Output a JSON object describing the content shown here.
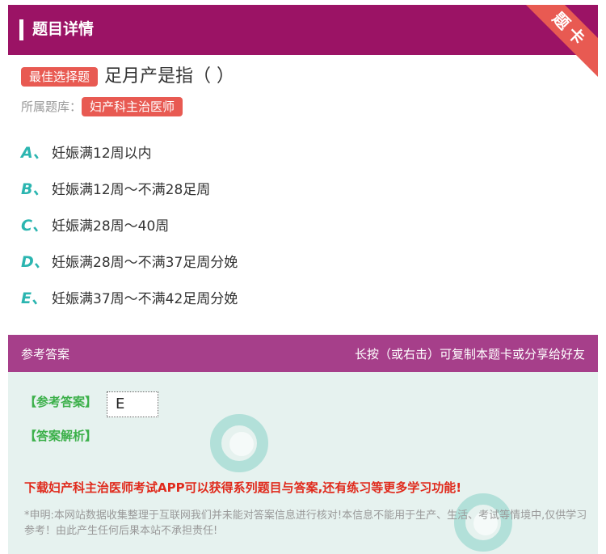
{
  "header": {
    "title": "题目详情",
    "corner_label": "题卡"
  },
  "question": {
    "type_tag": "最佳选择题",
    "text": "足月产是指（ ）"
  },
  "bank": {
    "label": "所属题库：",
    "name": "妇产科主治医师"
  },
  "options": [
    {
      "letter": "A、",
      "text": "妊娠满12周以内"
    },
    {
      "letter": "B、",
      "text": "妊娠满12周～不满28足周"
    },
    {
      "letter": "C、",
      "text": "妊娠满28周～40周"
    },
    {
      "letter": "D、",
      "text": "妊娠满28周～不满37足周分娩"
    },
    {
      "letter": "E、",
      "text": "妊娠满37周～不满42足周分娩"
    }
  ],
  "answer_bar": {
    "left": "参考答案",
    "right": "长按（或右击）可复制本题卡或分享给好友"
  },
  "answer": {
    "ref_label": "【参考答案】",
    "ref_value": "E",
    "explain_label": "【答案解析】"
  },
  "download_text": "下载妇产科主治医师考试APP可以获得系列题目与答案,还有练习等更多学习功能!",
  "disclaimer": "*申明:本网站数据收集整理于互联网我们并未能对答案信息进行核对!本信息不能用于生产、生活、考试等情境中,仅供学习参考！由此产生任何后果本站不承担责任!",
  "colors": {
    "header": "#9b1365",
    "tag": "#e85a52",
    "option_letter": "#2bb5b0",
    "answer_bar": "#a63f8a",
    "answer_panel": "#e6f2ef",
    "label_green": "#3cb04a",
    "download_red": "#e02a1c"
  }
}
